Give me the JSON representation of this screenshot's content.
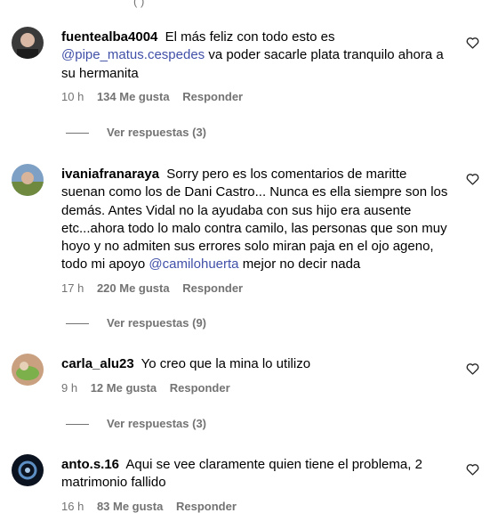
{
  "top_partial": "( )",
  "comments": [
    {
      "username": "fuentealba4004",
      "text_before": "El más feliz con todo esto es",
      "mention": "@pipe_matus.cespedes",
      "text_after": "va poder sacarle plata tranquilo ahora a su hermanita",
      "time": "10 h",
      "likes": "134 Me gusta",
      "reply": "Responder",
      "view_replies": "Ver respuestas (3)",
      "avatar_colors": [
        "#3a3a3a",
        "#d9b8a5"
      ]
    },
    {
      "username": "ivaniafranaraya",
      "text_before": "Sorry pero es los comentarios de maritte suenan como los de Dani Castro... Nunca es ella siempre son los demás. Antes Vidal no la ayudaba con sus hijo era ausente etc...ahora todo lo malo contra camilo, las personas que son muy hoyo y no admiten sus errores solo miran paja en el ojo ageno, todo mi apoyo",
      "mention": "@camilohuerta",
      "text_after": "mejor no decir nada",
      "time": "17 h",
      "likes": "220 Me gusta",
      "reply": "Responder",
      "view_replies": "Ver respuestas (9)",
      "avatar_colors": [
        "#7da0c4",
        "#6f8a3e"
      ]
    },
    {
      "username": "carla_alu23",
      "text_before": "Yo creo que la mina lo utilizo",
      "mention": "",
      "text_after": "",
      "time": "9 h",
      "likes": "12 Me gusta",
      "reply": "Responder",
      "view_replies": "Ver respuestas (3)",
      "avatar_colors": [
        "#c9a080",
        "#7bb04a"
      ]
    },
    {
      "username": "anto.s.16",
      "text_before": "Aqui se vee claramente quien tiene el problema, 2 matrimonio fallido",
      "mention": "",
      "text_after": "",
      "time": "16 h",
      "likes": "83 Me gusta",
      "reply": "Responder",
      "avatar_colors": [
        "#0b1320",
        "#5d8fc4"
      ]
    }
  ]
}
